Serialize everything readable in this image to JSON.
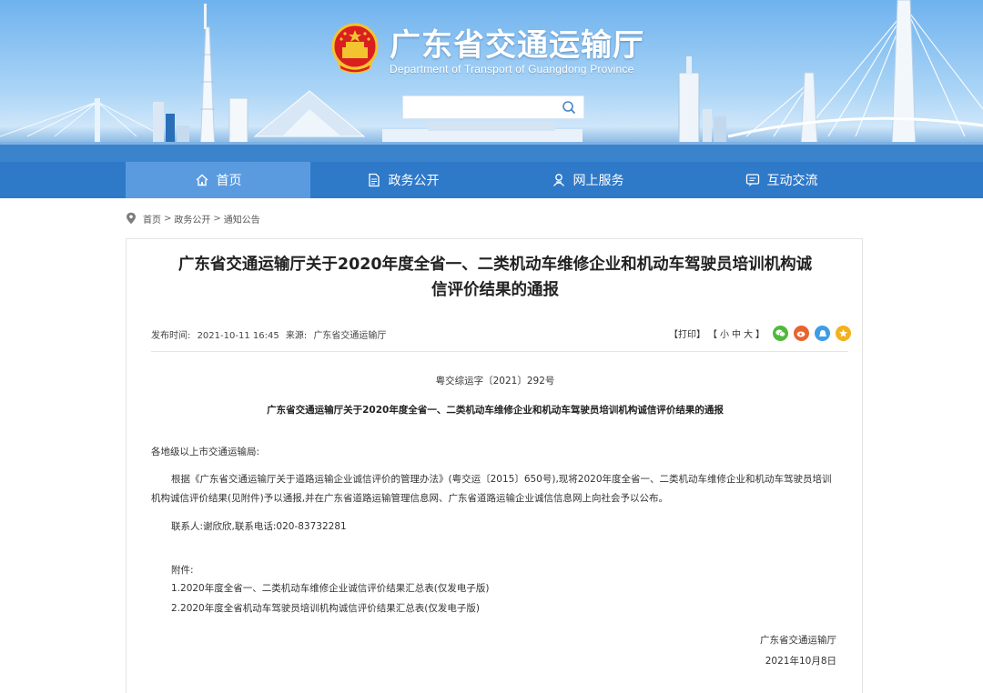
{
  "header": {
    "title": "广东省交通运输厅",
    "subtitle": "Department of Transport of Guangdong Province",
    "search": {
      "value": "",
      "placeholder": ""
    }
  },
  "nav": {
    "items": [
      {
        "label": "首页",
        "icon": "home-icon",
        "active": true
      },
      {
        "label": "政务公开",
        "icon": "document-icon",
        "active": false
      },
      {
        "label": "网上服务",
        "icon": "service-icon",
        "active": false
      },
      {
        "label": "互动交流",
        "icon": "chat-icon",
        "active": false
      }
    ]
  },
  "breadcrumb": {
    "items": [
      "首页",
      "政务公开",
      "通知公告"
    ],
    "separator": ">"
  },
  "article": {
    "title_line1": "广东省交通运输厅关于2020年度全省一、二类机动车维修企业和机动车驾驶员培训机构诚",
    "title_line2": "信评价结果的通报",
    "meta": {
      "publish_label": "发布时间:",
      "publish_time": "2021-10-11 16:45",
      "source_label": "来源:",
      "source": "广东省交通运输厅"
    },
    "tools": {
      "print": "【打印】",
      "font_open": "【",
      "small": "小",
      "medium": "中",
      "large": "大",
      "font_close": "】"
    },
    "share_icons": [
      {
        "name": "wechat-icon",
        "color": "#52b83d"
      },
      {
        "name": "weibo-icon",
        "color": "#e8642e"
      },
      {
        "name": "qzone-icon",
        "color": "#3d9de8"
      },
      {
        "name": "favorite-icon",
        "color": "#f2b21e"
      }
    ],
    "doc_number": "粤交综运字〔2021〕292号",
    "subtitle": "广东省交通运输厅关于2020年度全省一、二类机动车维修企业和机动车驾驶员培训机构诚信评价结果的通报",
    "salutation": "各地级以上市交通运输局:",
    "body": "根据《广东省交通运输厅关于道路运输企业诚信评价的管理办法》(粤交运〔2015〕650号),现将2020年度全省一、二类机动车维修企业和机动车驾驶员培训机构诚信评价结果(见附件)予以通报,并在广东省道路运输管理信息网、广东省道路运输企业诚信信息网上向社会予以公布。",
    "contact": "联系人:谢欣欣,联系电话:020-83732281",
    "attachment_label": "附件:",
    "attachments": [
      "1.2020年度全省一、二类机动车维修企业诚信评价结果汇总表(仅发电子版)",
      "2.2020年度全省机动车驾驶员培训机构诚信评价结果汇总表(仅发电子版)"
    ],
    "signature": "广东省交通运输厅",
    "sign_date": "2021年10月8日"
  },
  "colors": {
    "nav_bg": "#2f79c9",
    "nav_active": "#5a9be0",
    "banner_sky": "#8cc4f2"
  }
}
